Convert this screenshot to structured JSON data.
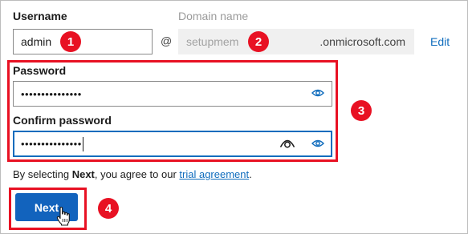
{
  "username": {
    "label": "Username",
    "value": "admin"
  },
  "domain": {
    "label": "Domain name",
    "value": "setupmem",
    "suffix": ".onmicrosoft.com",
    "at_sign": "@",
    "edit_link": "Edit"
  },
  "password": {
    "label": "Password",
    "masked_value": "•••••••••••••••"
  },
  "confirm_password": {
    "label": "Confirm password",
    "masked_value": "•••••••••••••••"
  },
  "agreement": {
    "prefix": "By selecting ",
    "bold": "Next",
    "middle": ", you agree to our ",
    "link": "trial agreement",
    "suffix": "."
  },
  "next_button": {
    "label": "Next"
  },
  "callouts": [
    "1",
    "2",
    "3",
    "4"
  ],
  "colors": {
    "accent": "#0f6cbd",
    "callout": "#e81123",
    "button": "#1263bd"
  },
  "icons": [
    "eye-icon",
    "eye-outline-icon",
    "hand-cursor-icon"
  ]
}
